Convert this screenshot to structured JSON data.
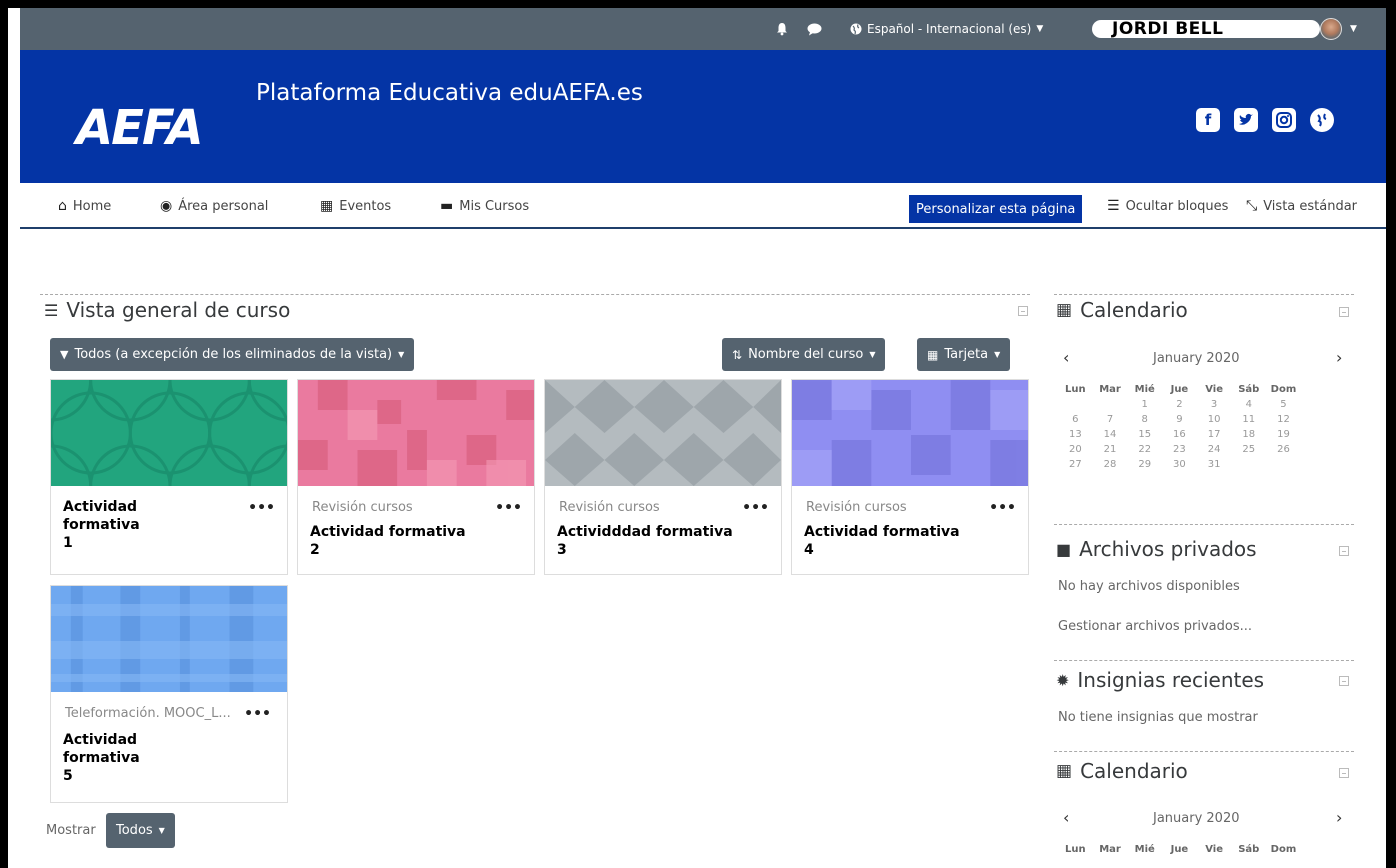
{
  "topbar": {
    "language": "Español - Internacional (es)",
    "user_name": "JORDI BELL"
  },
  "header": {
    "logo_text": "AEFA",
    "site_title": "Plataforma Educativa eduAEFA.es",
    "social_icons": [
      "facebook-icon",
      "twitter-icon",
      "instagram-icon",
      "globe-icon"
    ]
  },
  "nav": {
    "home": "Home",
    "personal_area": "Área personal",
    "events": "Eventos",
    "my_courses": "Mis Cursos",
    "customize": "Personalizar esta página",
    "hide_blocks": "Ocultar bloques",
    "standard_view": "Vista estándar"
  },
  "overview": {
    "title": "Vista general de curso",
    "filter_button": "Todos (a excepción de los eliminados de la vista)",
    "sort_button": "Nombre del curso",
    "view_button": "Tarjeta",
    "show_label": "Mostrar",
    "show_button": "Todos",
    "courses": [
      {
        "category": "",
        "name": "Actividad formativa",
        "number": "1",
        "color": "#22a57e"
      },
      {
        "category": "Revisión cursos",
        "name": "Actividad formativa",
        "number": "2",
        "color": "#ea7a9f"
      },
      {
        "category": "Revisión cursos",
        "name": "Actividddad formativa",
        "number": "3",
        "color": "#b4bbbf"
      },
      {
        "category": "Revisión cursos",
        "name": "Actividad formativa",
        "number": "4",
        "color": "#8f8ef2"
      },
      {
        "category": "Teleformación. MOOC_L...",
        "name": "Actividad formativa",
        "number": "5",
        "color": "#6fa8f0"
      }
    ]
  },
  "calendar": {
    "title": "Calendario",
    "month": "January 2020",
    "weekdays": [
      "Lun",
      "Mar",
      "Mié",
      "Jue",
      "Vie",
      "Sáb",
      "Dom"
    ],
    "weeks": [
      [
        "",
        "",
        "1",
        "2",
        "3",
        "4",
        "5"
      ],
      [
        "6",
        "7",
        "8",
        "9",
        "10",
        "11",
        "12"
      ],
      [
        "13",
        "14",
        "15",
        "16",
        "17",
        "18",
        "19"
      ],
      [
        "20",
        "21",
        "22",
        "23",
        "24",
        "25",
        "26"
      ],
      [
        "27",
        "28",
        "29",
        "30",
        "31",
        "",
        ""
      ]
    ]
  },
  "private_files": {
    "title": "Archivos privados",
    "empty": "No hay archivos disponibles",
    "manage_link": "Gestionar archivos privados..."
  },
  "badges": {
    "title": "Insignias recientes",
    "empty": "No tiene insignias que mostrar"
  },
  "calendar2": {
    "title": "Calendario",
    "month": "January 2020",
    "weekdays": [
      "Lun",
      "Mar",
      "Mié",
      "Jue",
      "Vie",
      "Sáb",
      "Dom"
    ]
  }
}
